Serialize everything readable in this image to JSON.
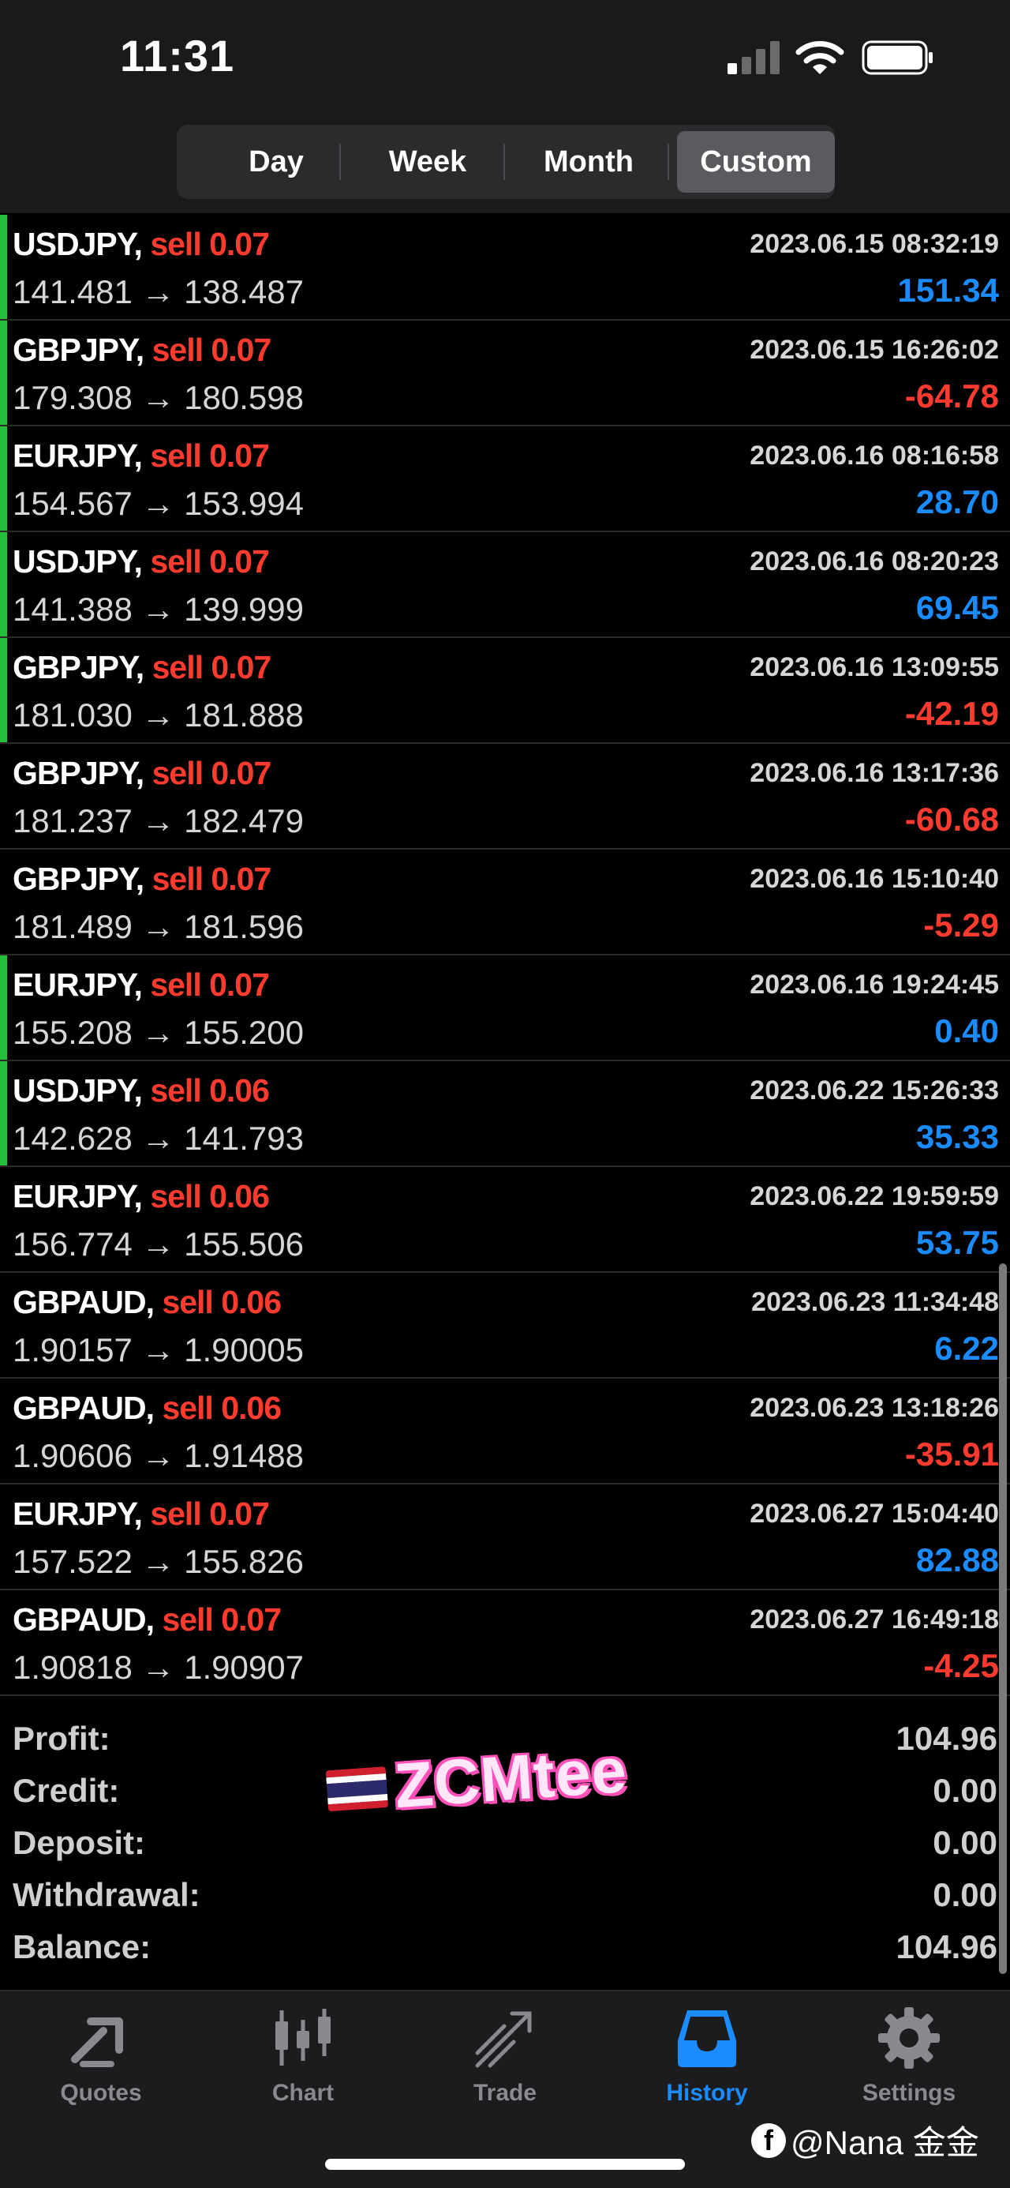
{
  "status_bar": {
    "time": "11:31"
  },
  "period_tabs": [
    {
      "label": "Day",
      "active": false
    },
    {
      "label": "Week",
      "active": false
    },
    {
      "label": "Month",
      "active": false
    },
    {
      "label": "Custom",
      "active": true
    }
  ],
  "trades": [
    {
      "symbol": "USDJPY,",
      "side": "sell 0.07",
      "time": "2023.06.15 08:32:19",
      "prices": "141.481 → 138.487",
      "pl": "151.34",
      "positive": true
    },
    {
      "symbol": "GBPJPY,",
      "side": "sell 0.07",
      "time": "2023.06.15 16:26:02",
      "prices": "179.308 → 180.598",
      "pl": "-64.78",
      "positive": false
    },
    {
      "symbol": "EURJPY,",
      "side": "sell 0.07",
      "time": "2023.06.16 08:16:58",
      "prices": "154.567 → 153.994",
      "pl": "28.70",
      "positive": true
    },
    {
      "symbol": "USDJPY,",
      "side": "sell 0.07",
      "time": "2023.06.16 08:20:23",
      "prices": "141.388 → 139.999",
      "pl": "69.45",
      "positive": true
    },
    {
      "symbol": "GBPJPY,",
      "side": "sell 0.07",
      "time": "2023.06.16 13:09:55",
      "prices": "181.030 → 181.888",
      "pl": "-42.19",
      "positive": false
    },
    {
      "symbol": "GBPJPY,",
      "side": "sell 0.07",
      "time": "2023.06.16 13:17:36",
      "prices": "181.237 → 182.479",
      "pl": "-60.68",
      "positive": false
    },
    {
      "symbol": "GBPJPY,",
      "side": "sell 0.07",
      "time": "2023.06.16 15:10:40",
      "prices": "181.489 → 181.596",
      "pl": "-5.29",
      "positive": false
    },
    {
      "symbol": "EURJPY,",
      "side": "sell 0.07",
      "time": "2023.06.16 19:24:45",
      "prices": "155.208 → 155.200",
      "pl": "0.40",
      "positive": true
    },
    {
      "symbol": "USDJPY,",
      "side": "sell 0.06",
      "time": "2023.06.22 15:26:33",
      "prices": "142.628 → 141.793",
      "pl": "35.33",
      "positive": true
    },
    {
      "symbol": "EURJPY,",
      "side": "sell 0.06",
      "time": "2023.06.22 19:59:59",
      "prices": "156.774 → 155.506",
      "pl": "53.75",
      "positive": true
    },
    {
      "symbol": "GBPAUD,",
      "side": "sell 0.06",
      "time": "2023.06.23 11:34:48",
      "prices": "1.90157 → 1.90005",
      "pl": "6.22",
      "positive": true
    },
    {
      "symbol": "GBPAUD,",
      "side": "sell 0.06",
      "time": "2023.06.23 13:18:26",
      "prices": "1.90606 → 1.91488",
      "pl": "-35.91",
      "positive": false
    },
    {
      "symbol": "EURJPY,",
      "side": "sell 0.07",
      "time": "2023.06.27 15:04:40",
      "prices": "157.522 → 155.826",
      "pl": "82.88",
      "positive": true
    },
    {
      "symbol": "GBPAUD,",
      "side": "sell 0.07",
      "time": "2023.06.27 16:49:18",
      "prices": "1.90818 → 1.90907",
      "pl": "-4.25",
      "positive": false
    }
  ],
  "summary": [
    {
      "label": "Profit:",
      "value": "104.96"
    },
    {
      "label": "Credit:",
      "value": "0.00"
    },
    {
      "label": "Deposit:",
      "value": "0.00"
    },
    {
      "label": "Withdrawal:",
      "value": "0.00"
    },
    {
      "label": "Balance:",
      "value": "104.96"
    }
  ],
  "watermark": {
    "text": "ZCMtee"
  },
  "tab_bar": [
    {
      "label": "Quotes",
      "icon": "quotes-icon",
      "active": false
    },
    {
      "label": "Chart",
      "icon": "candlestick-icon",
      "active": false
    },
    {
      "label": "Trade",
      "icon": "trade-icon",
      "active": false
    },
    {
      "label": "History",
      "icon": "inbox-icon",
      "active": true
    },
    {
      "label": "Settings",
      "icon": "gear-icon",
      "active": false
    }
  ],
  "credit": {
    "text": "@Nana 金金"
  },
  "colors": {
    "profit": "#1a8cff",
    "loss": "#ff3b30",
    "marker": "#26c13a",
    "active_tab": "#1a8cff"
  }
}
